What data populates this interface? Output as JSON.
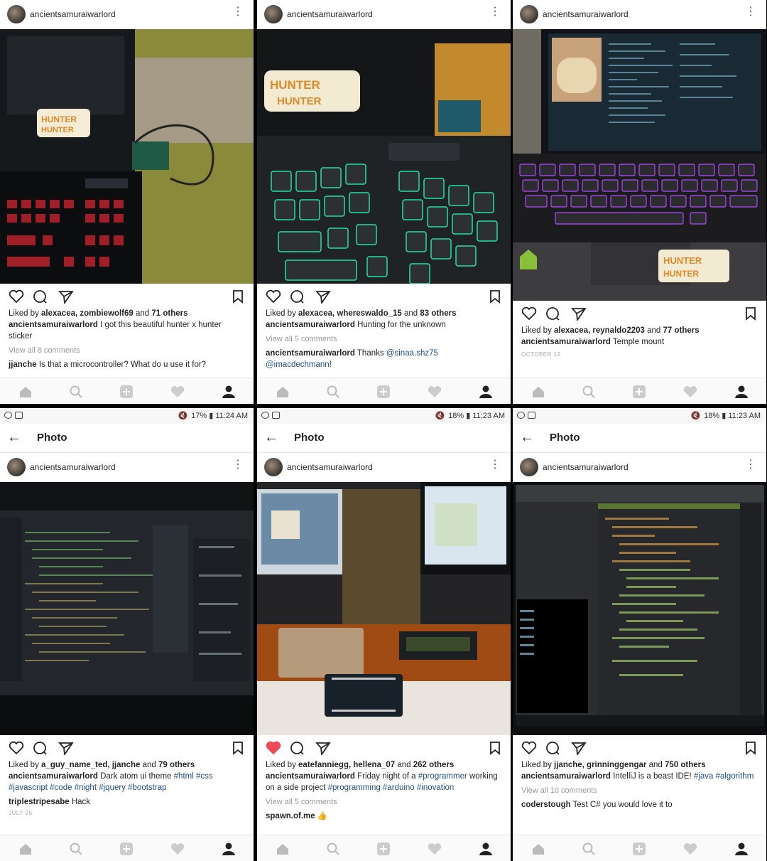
{
  "username": "ancientsamuraiwarlord",
  "photo_bar_title": "Photo",
  "colors": {
    "tag": "#1e4f8a",
    "liked_heart": "#ed4956",
    "muted": "#999999"
  },
  "icons": [
    "heart-icon",
    "comment-icon",
    "share-icon",
    "bookmark-icon",
    "home-icon",
    "search-icon",
    "add-icon",
    "activity-icon",
    "profile-icon",
    "back-arrow-icon",
    "more-icon"
  ],
  "posts": [
    {
      "liked": false,
      "likes_prefix": "Liked by ",
      "likes_names": "alexacea, zombiewolf69",
      "likes_and": " and ",
      "likes_count": "71 others",
      "caption": "I got this beautiful hunter x hunter sticker",
      "view_comments": "View all 8 comments",
      "comment_user": "jjanche",
      "comment_text": "Is that a microcontroller? What do u use it for?"
    },
    {
      "liked": false,
      "likes_prefix": "Liked by ",
      "likes_names": "alexacea, whereswaldo_15",
      "likes_and": " and ",
      "likes_count": "83 others",
      "caption": "Hunting for the unknown",
      "view_comments": "View all 5 comments",
      "comment_user": "ancientsamuraiwarlord",
      "comment_text": "Thanks ",
      "comment_tags": "@sinaa.shz75 @imacdechmann",
      "comment_end": "!"
    },
    {
      "liked": false,
      "likes_prefix": "Liked by ",
      "likes_names": "alexacea, reynaldo2203",
      "likes_and": " and ",
      "likes_count": "77 others",
      "caption": "Temple mount",
      "date": "OCTOBER 12"
    },
    {
      "status_time": "17% ▮ 11:24 AM",
      "liked": false,
      "likes_prefix": "Liked by ",
      "likes_names": "a_guy_name_ted, jjanche",
      "likes_and": " and ",
      "likes_count": "79 others",
      "caption": "Dark atom ui theme ",
      "caption_tags": "#html #css #javascript #code #night #jquery #bootstrap",
      "comment_user": "triplestripesabe",
      "comment_text": "Hack",
      "date": "JULY 26"
    },
    {
      "status_time": "18% ▮ 11:23 AM",
      "liked": true,
      "likes_prefix": "Liked by ",
      "likes_names": "eatefanniegg, hellena_07",
      "likes_and": " and ",
      "likes_count": "262 others",
      "caption": "Friday night of a ",
      "caption_tag1": "#programmer",
      "caption_mid": " working on a side project ",
      "caption_tags": "#programming #arduino #inovation",
      "view_comments": "View all 5 comments",
      "comment_user": "spawn.of.me",
      "comment_text": "👍"
    },
    {
      "status_time": "18% ▮ 11:23 AM",
      "liked": false,
      "likes_prefix": "Liked by ",
      "likes_names": "jjanche, grinninggengar",
      "likes_and": " and ",
      "likes_count": "750 others",
      "caption": "IntelliJ is a beast IDE! ",
      "caption_tags": "#java #algorithm",
      "view_comments": "View all 10 comments",
      "comment_user": "coderstough",
      "comment_text": "Test C# you would love it to"
    }
  ]
}
